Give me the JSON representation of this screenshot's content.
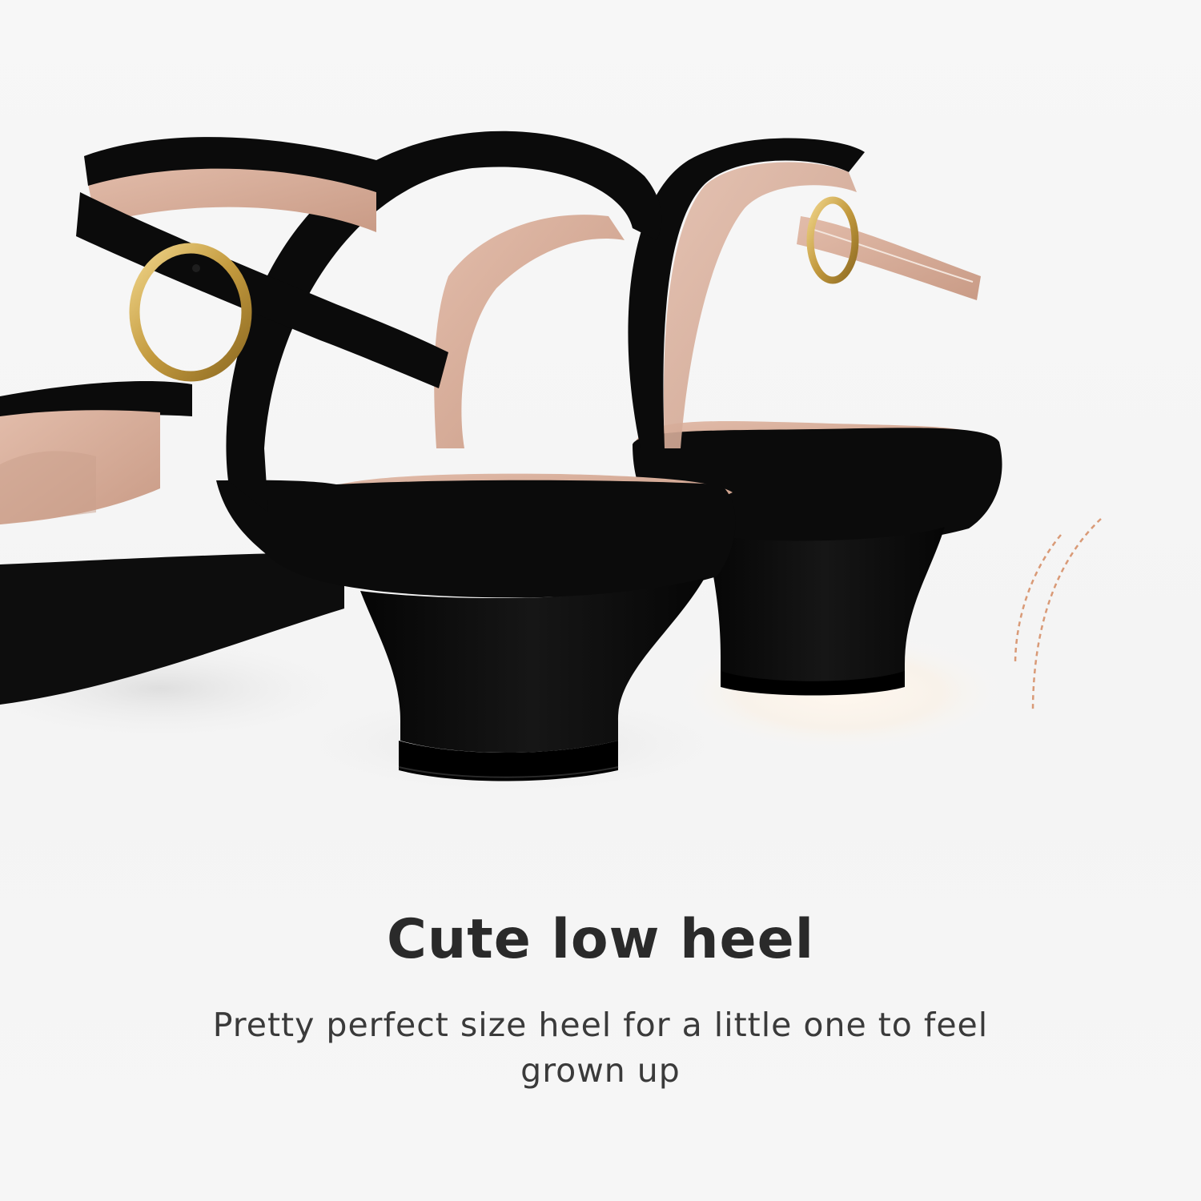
{
  "headline": "Cute low heel",
  "subheadline": "Pretty perfect size heel for a little one to feel grown up",
  "colors": {
    "background": "#f6f6f6",
    "suede": "#0b0b0b",
    "lining": "#d7ab97",
    "buckle": "#c9a24a",
    "accent_lines": "#d99a77",
    "headline_text": "#2a2a2a",
    "body_text": "#3a3a3a"
  },
  "icons": [
    "motion-lines-icon"
  ]
}
